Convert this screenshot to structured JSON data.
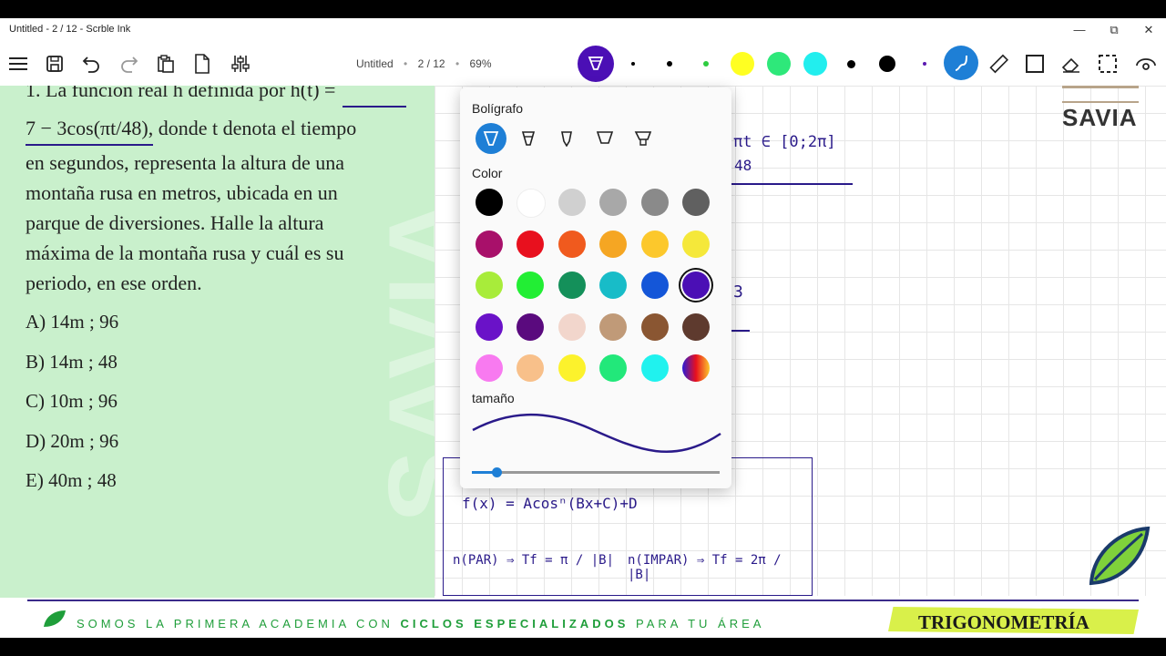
{
  "window": {
    "title": "Untitled - 2 / 12 - Scrble Ink",
    "minimize_glyph": "—",
    "restore_glyph": "⧉",
    "close_glyph": "✕"
  },
  "toolbar": {
    "doc_name": "Untitled",
    "page": "2 / 12",
    "zoom": "69%",
    "icons": [
      "menu-icon",
      "save-icon",
      "undo-icon",
      "redo-icon",
      "clipboard-icon",
      "page-icon",
      "settings-sliders-icon",
      "pen-icon",
      "highlighter-squiggle-icon",
      "ruler-icon",
      "shape-square-icon",
      "eraser-icon",
      "lasso-select-icon",
      "view-icon"
    ],
    "palette_colors": [
      "#000000",
      "#000000",
      "#2ecc40",
      "#ffff22",
      "#2ee87a",
      "#22eeee",
      "#000000",
      "#000000",
      "#5b1ab0"
    ]
  },
  "question": {
    "text_1": "1. La función real h definida por h(t) =",
    "text_2": "7 − 3cos(πt/48), donde t denota el tiempo",
    "text_3": "en segundos, representa la altura de una",
    "text_4": "montaña rusa en metros, ubicada en un",
    "text_5": "parque de diversiones. Halle la altura",
    "text_6": "máxima de la montaña rusa y cuál es su",
    "text_7": "periodo, en ese orden.",
    "options": [
      "A) 14m ; 96",
      "B) 14m ; 48",
      "C) 10m ; 96",
      "D) 20m ; 96",
      "E) 40m ; 48"
    ]
  },
  "handwriting": {
    "line_1": "πt ∈ [0;2π]",
    "line_2": "48",
    "fragment_3": "3",
    "formula": "f(x) = Acosⁿ(Bx+C)+D",
    "par": "n(PAR) ⇒ Tf = π / |B|",
    "impar": "n(IMPAR) ⇒ Tf = 2π / |B|"
  },
  "popup": {
    "pen_label": "Bolígrafo",
    "color_label": "Color",
    "size_label": "tamaño",
    "selected_color": "#4b0fb5",
    "size_value": 0.1,
    "colors": [
      "#000000",
      "#ffffff",
      "#d0d0d0",
      "#a8a8a8",
      "#8a8a8a",
      "#606060",
      "#a8106a",
      "#e8101e",
      "#f05a1e",
      "#f5a623",
      "#fcc82c",
      "#f5e83a",
      "#a8ec3a",
      "#22ee34",
      "#14905a",
      "#18bcc8",
      "#1456d8",
      "#4b0fb5",
      "#6a12c8",
      "#5a0a7e",
      "#f2d6cc",
      "#c09a78",
      "#8a5632",
      "#5e3a2e",
      "#f87af0",
      "#f8c08a",
      "#fcf22c",
      "#22e87a",
      "#20f2ee",
      "gradient"
    ]
  },
  "branding": {
    "logo_text": "SAVIA",
    "footer_prefix": "SOMOS LA PRIMERA ACADEMIA CON ",
    "footer_bold": "CICLOS ESPECIALIZADOS",
    "footer_suffix": " PARA TU ÁREA",
    "subject": "TRIGONOMETRÍA",
    "accent": "#1f9e3a",
    "lime": "#d9f04a"
  }
}
